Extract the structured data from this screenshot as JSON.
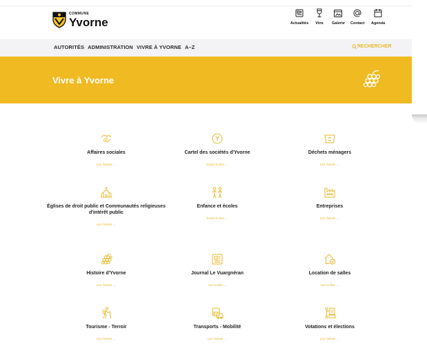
{
  "header": {
    "logo_small": "COMMUNE",
    "logo_name": "Yvorne",
    "quick_links": [
      {
        "label": "Actualités",
        "icon": "newspaper-icon"
      },
      {
        "label": "Vins",
        "icon": "wine-glass-icon"
      },
      {
        "label": "Galerie",
        "icon": "gallery-icon"
      },
      {
        "label": "Contact",
        "icon": "at-sign-icon"
      },
      {
        "label": "Agenda",
        "icon": "calendar-icon"
      }
    ]
  },
  "nav": {
    "items": [
      "AUTORITÉS",
      "ADMINISTRATION",
      "VIVRE À YVORNE",
      "A–Z"
    ],
    "search_label": "RECHERCHER"
  },
  "hero": {
    "title": "Vivre à Yvorne",
    "icon": "grapes-icon"
  },
  "cards": [
    {
      "title": "Affaires sociales",
      "link": "Lire l'article →",
      "icon": "handshake-icon"
    },
    {
      "title": "Cartel des sociétés d'Yvorne",
      "link": "Suivre le lien →",
      "icon": "circle-y-icon"
    },
    {
      "title": "Déchets ménagers",
      "link": "Lire l'article →",
      "icon": "recycle-bin-icon"
    },
    {
      "title": "Églises de droit public et Communautés religieuses d'intérêt public",
      "link": "Lire l'article →",
      "icon": "church-icon"
    },
    {
      "title": "Enfance et écoles",
      "link": "Suivre le lien →",
      "icon": "children-icon"
    },
    {
      "title": "Entreprises",
      "link": "Lire l'article →",
      "icon": "factory-icon"
    },
    {
      "title": "Histoire d'Yvorne",
      "link": "Lire l'article →",
      "icon": "grapes-icon"
    },
    {
      "title": "Journal Le Vuargnéran",
      "link": "Voir la liste →",
      "icon": "newspaper-icon"
    },
    {
      "title": "Location de salles",
      "link": "Voir la liste →",
      "icon": "house-check-icon"
    },
    {
      "title": "Tourisme - Terroir",
      "link": "Lire l'article →",
      "icon": "hiker-icon"
    },
    {
      "title": "Transports - Mobilité",
      "link": "Lire l'article →",
      "icon": "bus-icon"
    },
    {
      "title": "Votations et élections",
      "link": "Lire l'article →",
      "icon": "ballot-icon"
    }
  ],
  "colors": {
    "accent": "#efba22",
    "nav_bg": "#f3f3f5",
    "text": "#1f1f1f"
  }
}
